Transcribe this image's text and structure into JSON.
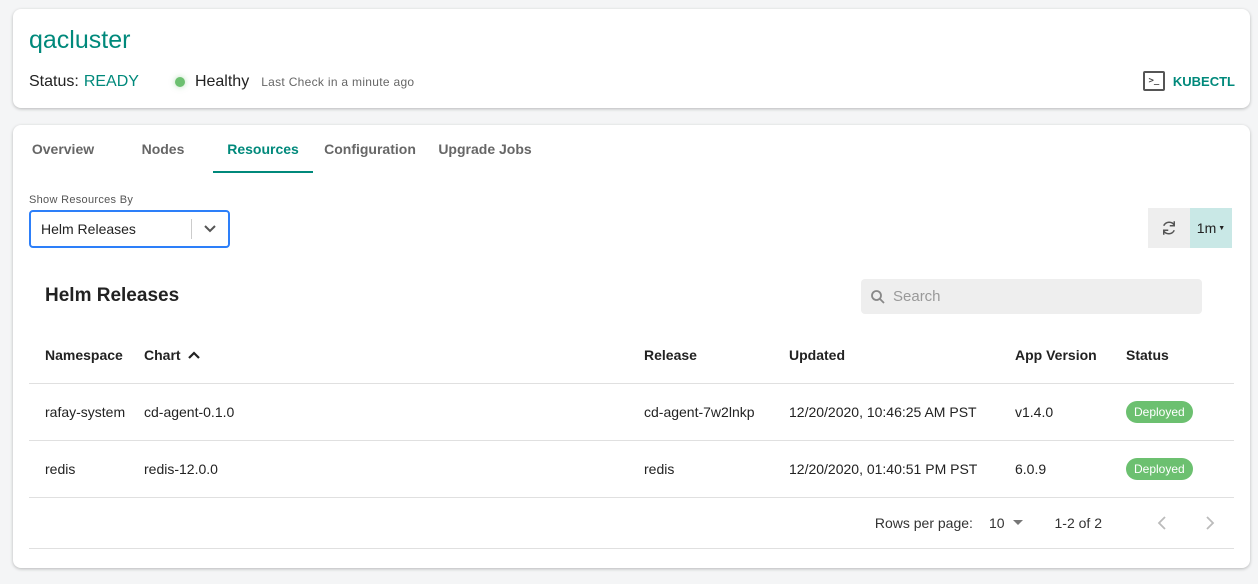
{
  "header": {
    "cluster_name": "qacluster",
    "status_label": "Status:",
    "status_value": "READY",
    "health": "Healthy",
    "last_check": "Last Check in a minute ago",
    "kubectl_label": "KUBECTL",
    "kubectl_icon_glyph": ">_"
  },
  "tabs": [
    {
      "label": "Overview",
      "active": false
    },
    {
      "label": "Nodes",
      "active": false
    },
    {
      "label": "Resources",
      "active": true
    },
    {
      "label": "Configuration",
      "active": false
    },
    {
      "label": "Upgrade Jobs",
      "active": false
    }
  ],
  "filter": {
    "label": "Show Resources By",
    "value": "Helm Releases"
  },
  "refresh": {
    "interval": "1m"
  },
  "table": {
    "title": "Helm Releases",
    "search_placeholder": "Search",
    "columns": [
      "Namespace",
      "Chart",
      "Release",
      "Updated",
      "App Version",
      "Status"
    ],
    "sorted_column": "Chart",
    "sort_direction": "ascending",
    "rows": [
      {
        "namespace": "rafay-system",
        "chart": "cd-agent-0.1.0",
        "release": "cd-agent-7w2lnkp",
        "updated": "12/20/2020, 10:46:25 AM PST",
        "app_version": "v1.4.0",
        "status": "Deployed"
      },
      {
        "namespace": "redis",
        "chart": "redis-12.0.0",
        "release": "redis",
        "updated": "12/20/2020, 01:40:51 PM PST",
        "app_version": "6.0.9",
        "status": "Deployed"
      }
    ]
  },
  "pagination": {
    "rows_per_page_label": "Rows per page:",
    "rows_per_page": "10",
    "range": "1-2 of 2"
  },
  "colors": {
    "accent": "#00897b",
    "healthy": "#6cc070",
    "select_border": "#2d7ff9",
    "interval_bg": "#c9e8e6"
  }
}
